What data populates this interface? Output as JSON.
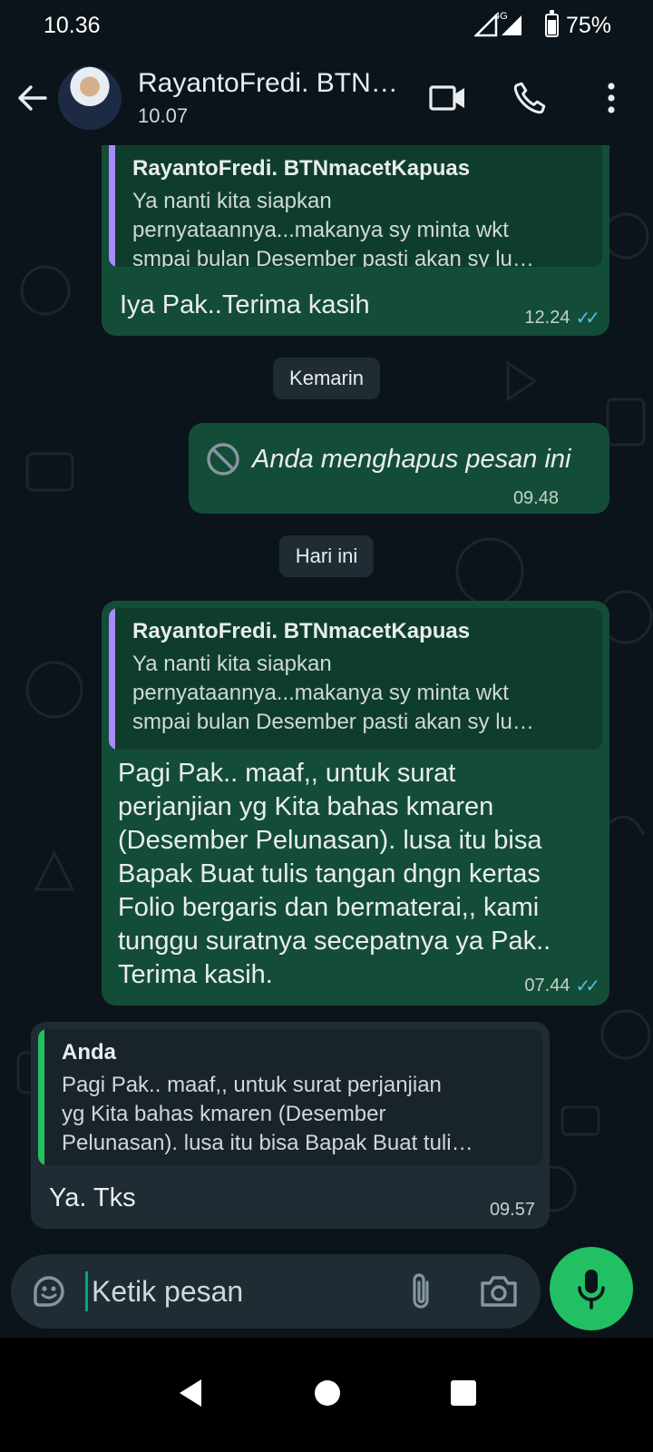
{
  "status_bar": {
    "time": "10.36",
    "network": "4G",
    "battery": "75%"
  },
  "header": {
    "contact_name": "RayantoFredi. BTN…",
    "subtitle": "10.07",
    "icons": [
      "back-arrow-icon",
      "video-call-icon",
      "voice-call-icon",
      "more-options-icon"
    ]
  },
  "messages": [
    {
      "direction": "outgoing",
      "quote": {
        "author": "RayantoFredi. BTNmacetKapuas",
        "lines": [
          "Ya nanti kita siapkan",
          "pernyataannya...makanya sy minta wkt",
          "smpai bulan Desember pasti akan sy lu…"
        ]
      },
      "text": "Iya Pak..Terima kasih",
      "time": "12.24",
      "status": "read"
    },
    {
      "type": "date",
      "label": "Kemarin"
    },
    {
      "direction": "outgoing",
      "deleted": true,
      "text": "Anda menghapus pesan ini",
      "time": "09.48"
    },
    {
      "type": "date",
      "label": "Hari ini"
    },
    {
      "direction": "outgoing",
      "quote": {
        "author": "RayantoFredi. BTNmacetKapuas",
        "lines": [
          "Ya nanti kita siapkan",
          "pernyataannya...makanya sy minta wkt",
          "smpai bulan Desember pasti akan sy lu…"
        ]
      },
      "lines": [
        "Pagi Pak.. maaf,, untuk surat",
        "perjanjian yg Kita bahas kmaren",
        "(Desember Pelunasan). lusa itu bisa",
        "Bapak Buat tulis tangan dngn kertas",
        "Folio bergaris dan bermaterai,, kami",
        "tunggu suratnya secepatnya ya Pak..",
        "Terima kasih."
      ],
      "time": "07.44",
      "status": "read"
    },
    {
      "direction": "incoming",
      "quote": {
        "author": "Anda",
        "lines": [
          "Pagi Pak.. maaf,, untuk surat perjanjian",
          "yg Kita bahas kmaren (Desember",
          "Pelunasan). lusa itu bisa Bapak Buat tuli…"
        ]
      },
      "text": "Ya. Tks",
      "time": "09.57"
    }
  ],
  "composer": {
    "placeholder": "Ketik pesan",
    "icons": [
      "sticker-icon",
      "attach-icon",
      "camera-icon",
      "mic-icon"
    ]
  },
  "colors": {
    "background": "#0b141a",
    "outgoing_bubble": "#144d37",
    "incoming_bubble": "#1f2c34",
    "accent_green": "#21c063",
    "read_ticks": "#53bdeb"
  }
}
